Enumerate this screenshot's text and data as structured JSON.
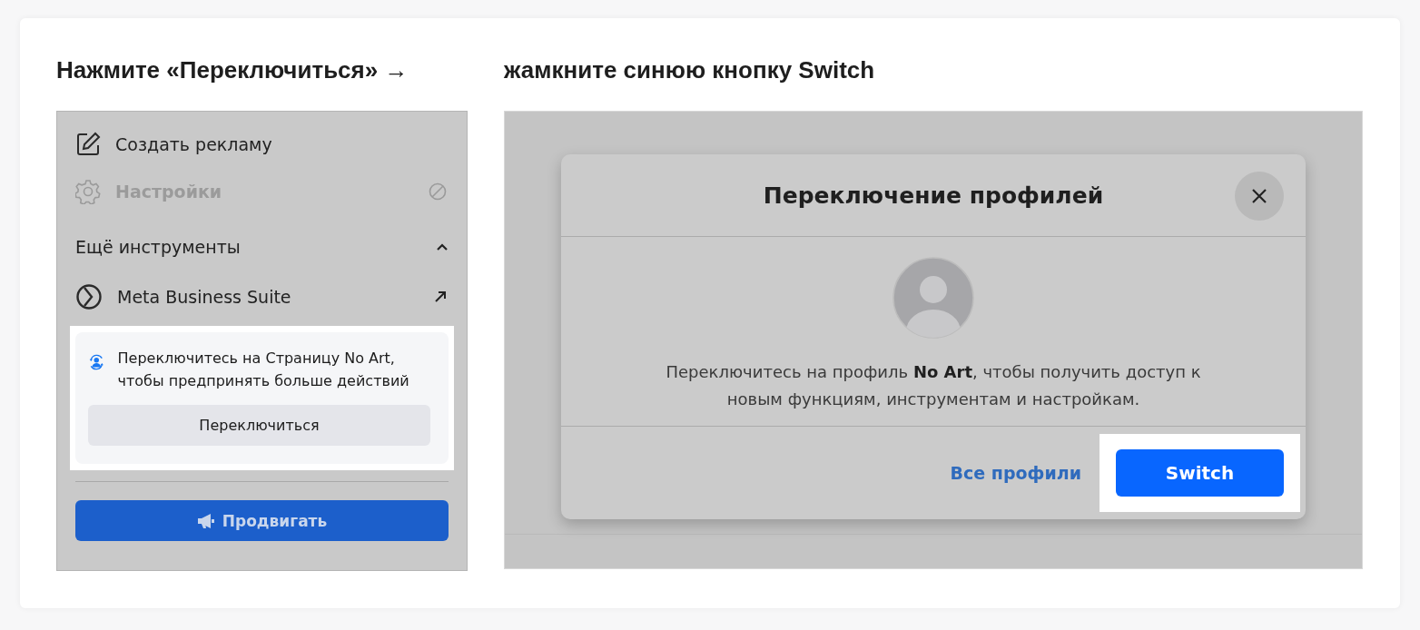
{
  "left": {
    "caption": "Нажмите «Переключиться» →",
    "menu_items": [
      {
        "kind": "edit",
        "label": "Создать рекламу",
        "disabled": false
      },
      {
        "kind": "gear",
        "label": "Настройки",
        "disabled": true
      }
    ],
    "section": {
      "label": "Ещё инструменты",
      "expanded": true
    },
    "links": [
      {
        "kind": "meta",
        "label": "Meta Business Suite"
      }
    ],
    "notice": {
      "text": "Переключитесь на Страницу No Art, чтобы предпринять больше действий",
      "button": "Переключиться",
      "highlighted": true
    },
    "promote_button": "Продвигать"
  },
  "right": {
    "caption": "жамкните синюю кнопку Switch",
    "dialog": {
      "title": "Переключение профилей",
      "message": "Переключитесь на профиль **No Art**, чтобы получить доступ к новым функциям, инструментам и настройкам.",
      "secondary_button": "Все профили",
      "primary_button": "Switch",
      "primary_highlighted": true
    }
  }
}
